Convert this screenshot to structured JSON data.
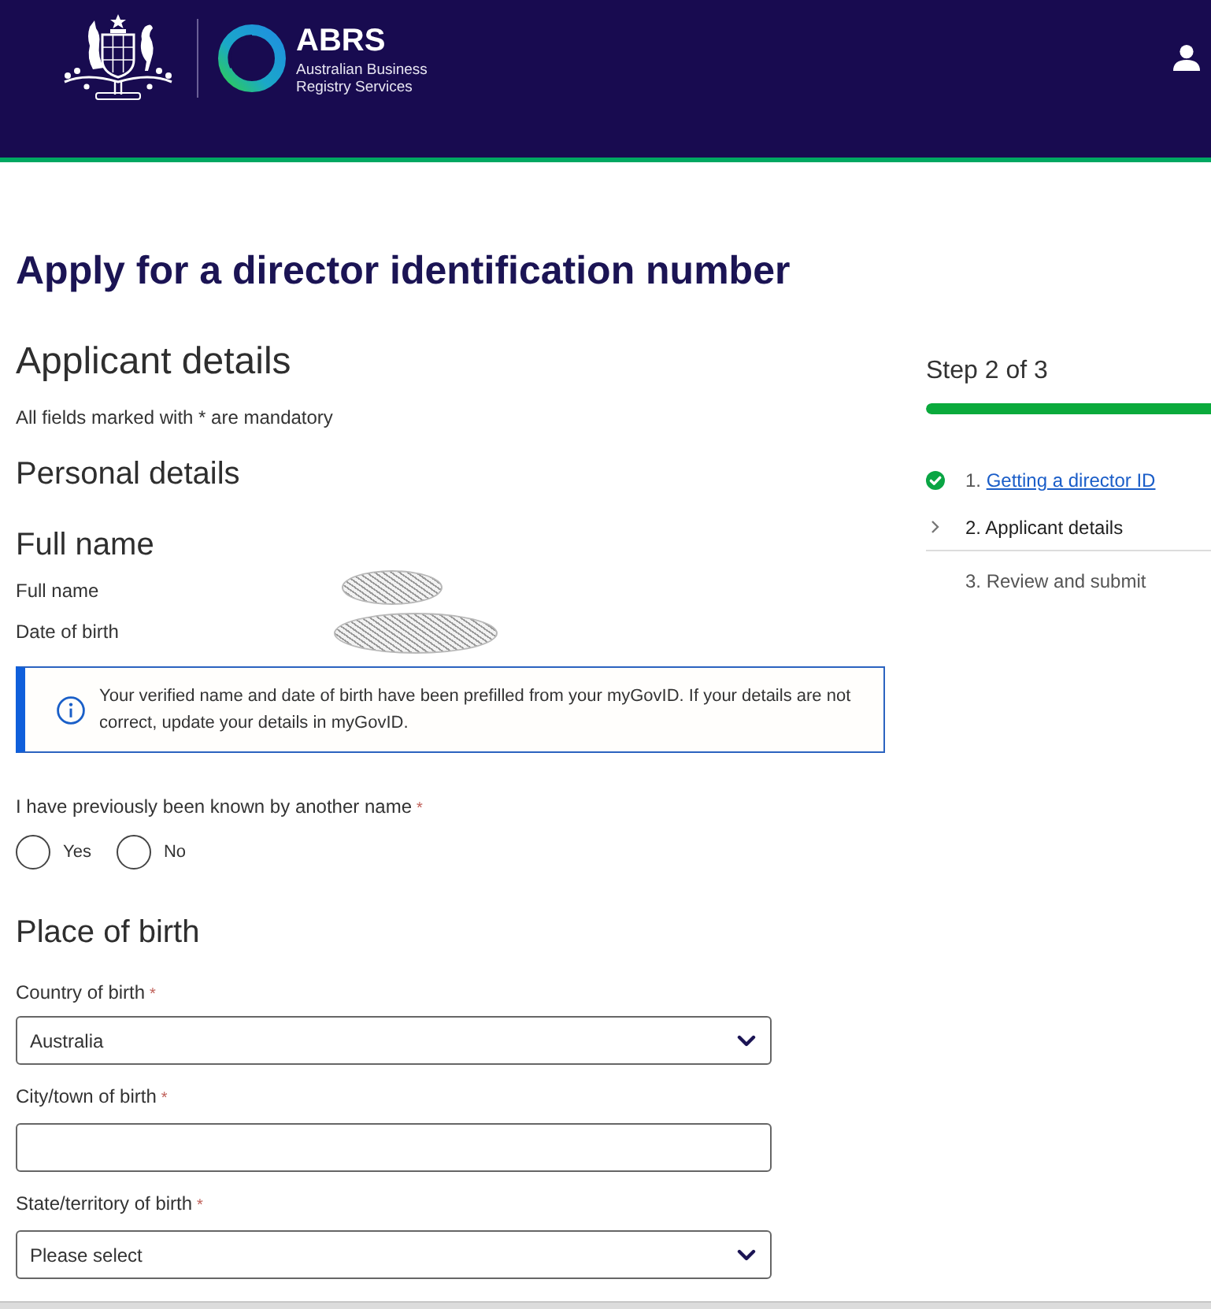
{
  "header": {
    "logo_title": "ABRS",
    "logo_subtitle": "Australian Business Registry Services"
  },
  "page_title": "Apply for a director identification number",
  "form": {
    "heading": "Applicant details",
    "note": "All fields marked with * are mandatory",
    "section_heading": "Personal details",
    "full_name": {
      "heading": "Full name",
      "rows": [
        {
          "label": "Full name",
          "redacted": true
        },
        {
          "label": "Date of birth",
          "redacted": true
        }
      ]
    },
    "info_message": "Your verified name and date of birth have been prefilled from your myGovID. If your details are not correct, update your details in myGovID.",
    "question": {
      "label": "I have previously been known by another name",
      "required_mark": "*",
      "options": [
        {
          "label": "Yes",
          "selected": false
        },
        {
          "label": "No",
          "selected": false
        }
      ]
    },
    "place_of_birth": {
      "heading": "Place of birth",
      "fields": [
        {
          "kind": "select",
          "label": "Country of birth",
          "required_mark": "*",
          "value": "Australia"
        },
        {
          "kind": "text",
          "label": "City/town of birth",
          "required_mark": "*"
        },
        {
          "kind": "select",
          "label": "State/territory of birth",
          "required_mark": "*",
          "value": "Please select"
        }
      ]
    }
  },
  "progress": {
    "title": "Step 2 of 3",
    "level": 1,
    "steps": [
      {
        "number": "1.",
        "label": "Getting a director ID",
        "completed": true,
        "current": false
      },
      {
        "number": "2.",
        "label": "Applicant details",
        "completed": false,
        "current": true
      },
      {
        "number": "3.",
        "label": "Review and submit",
        "completed": false,
        "current": false
      }
    ]
  }
}
